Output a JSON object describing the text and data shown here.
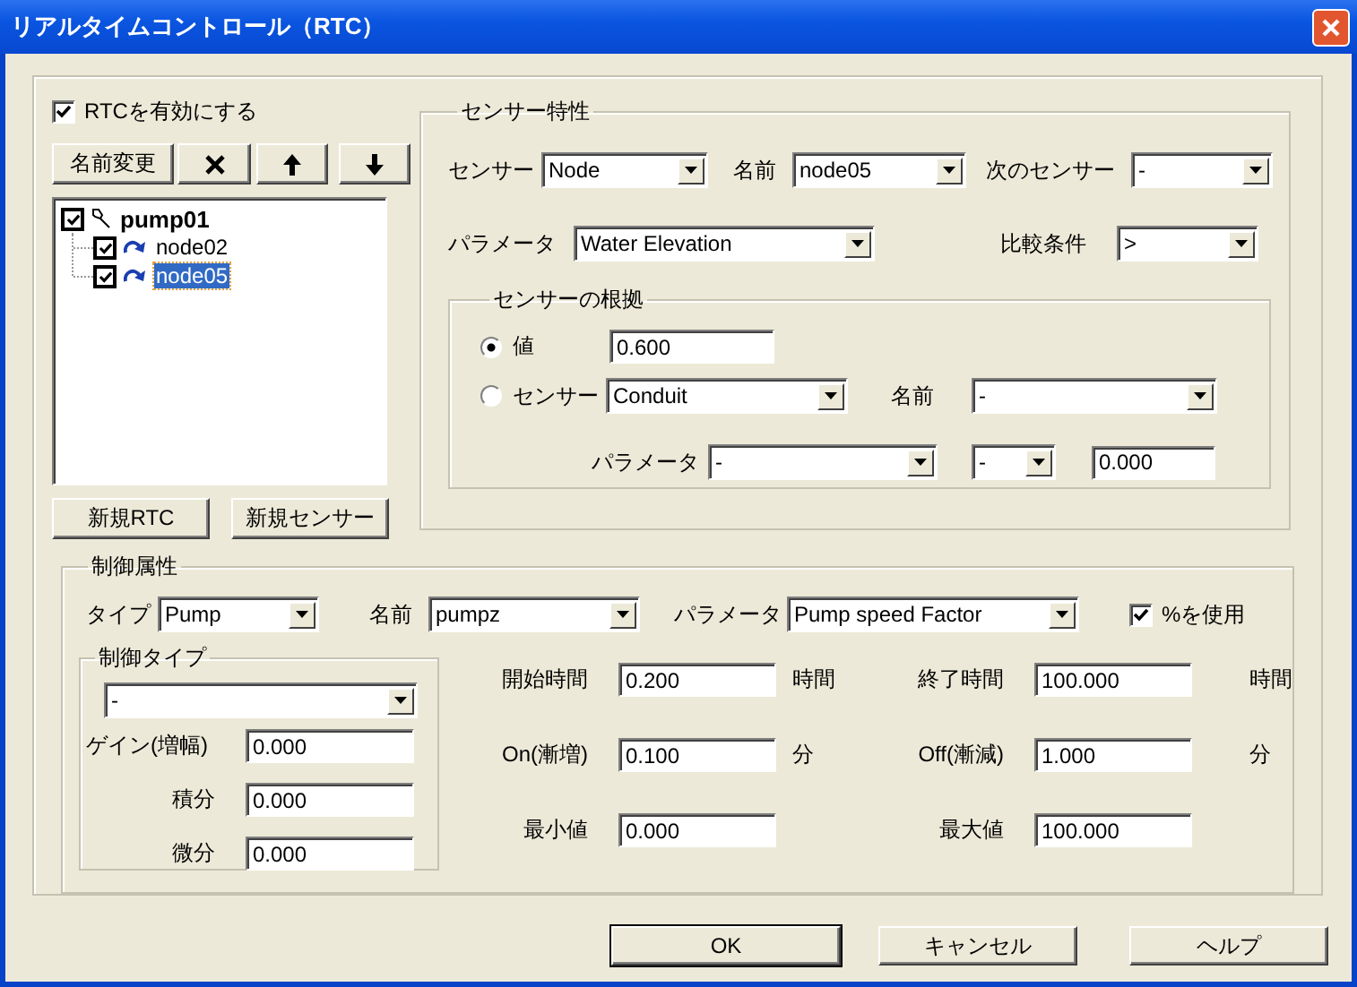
{
  "window": {
    "title": "リアルタイムコントロール（RTC）"
  },
  "enable_rtc": {
    "label": "RTCを有効にする",
    "checked": true
  },
  "toolbar": [
    {
      "kind": "text",
      "label": "名前変更"
    },
    {
      "kind": "delete"
    },
    {
      "kind": "up"
    },
    {
      "kind": "down"
    }
  ],
  "tree": [
    {
      "label": "pump01",
      "checked": true,
      "selected": false,
      "children": [
        {
          "label": "node02",
          "checked": true,
          "selected": false
        },
        {
          "label": "node05",
          "checked": true,
          "selected": true
        }
      ]
    }
  ],
  "tree_buttons": [
    "新規RTC",
    "新規センサー"
  ],
  "sensor": {
    "title": "センサー特性",
    "sensor": {
      "label": "センサー",
      "value": "Node"
    },
    "name": {
      "label": "名前",
      "value": "node05"
    },
    "next": {
      "label": "次のセンサー",
      "value": "-"
    },
    "parameter": {
      "label": "パラメータ",
      "value": "Water Elevation"
    },
    "comparison": {
      "label": "比較条件",
      "value": ">"
    },
    "basis": {
      "title": "センサーの根拠",
      "options": [
        {
          "label": "値",
          "selected": true
        },
        {
          "label": "センサー",
          "selected": false
        }
      ],
      "value": "0.600",
      "sensor_type": "Conduit",
      "name": {
        "label": "名前",
        "value": "-"
      },
      "parameter": {
        "label": "パラメータ",
        "value": "-",
        "operator": "-",
        "amount": "0.000"
      }
    }
  },
  "control": {
    "title": "制御属性",
    "type": {
      "label": "タイプ",
      "value": "Pump"
    },
    "name": {
      "label": "名前",
      "value": "pumpz"
    },
    "parameter": {
      "label": "パラメータ",
      "value": "Pump speed Factor"
    },
    "use_percent": {
      "label": "%を使用",
      "checked": true
    },
    "control_type": {
      "title": "制御タイプ",
      "value": "-",
      "gains": [
        {
          "label": "ゲイン(増幅)",
          "value": "0.000"
        },
        {
          "label": "積分",
          "value": "0.000"
        },
        {
          "label": "微分",
          "value": "0.000"
        }
      ]
    },
    "timing": [
      [
        {
          "label": "開始時間",
          "value": "0.200",
          "unit": "時間"
        },
        {
          "label": "終了時間",
          "value": "100.000",
          "unit": "時間"
        }
      ],
      [
        {
          "label": "On(漸増)",
          "value": "0.100",
          "unit": "分"
        },
        {
          "label": "Off(漸減)",
          "value": "1.000",
          "unit": "分"
        }
      ],
      [
        {
          "label": "最小値",
          "value": "0.000"
        },
        {
          "label": "最大値",
          "value": "100.000"
        }
      ]
    ]
  },
  "buttons": [
    {
      "label": "OK",
      "default": true
    },
    {
      "label": "キャンセル",
      "default": false
    },
    {
      "label": "ヘルプ",
      "default": false
    }
  ]
}
